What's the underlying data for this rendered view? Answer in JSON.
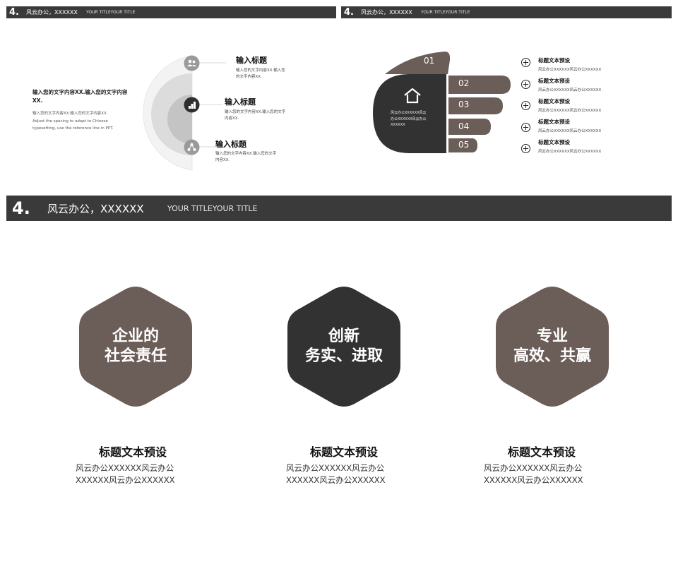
{
  "header": {
    "number": "4.",
    "title": "风云办公，XXXXXX",
    "subtitle": "YOUR TITLEYOUR TITLE"
  },
  "slide1": {
    "intro_title": "输入您的文字内容XX.输入您的文字内容XX.",
    "intro_body": "输入您的文字内容XX.输入您的文字内容XX.\nAdjust the spacing to adapt to Chinese\ntypesetting, use the reference line in PPT.",
    "items": [
      {
        "icon": "people-icon",
        "title": "输入标题",
        "body": "输入您的文字内容XX.输入您\n的文字内容XX."
      },
      {
        "icon": "steps-icon",
        "title": "输入标题",
        "body": "输入您的文字内容XX.输入您的文字\n内容XX."
      },
      {
        "icon": "network-icon",
        "title": "输入标题",
        "body": "输入您的文字内容XX.输入您的文字\n内容XX."
      }
    ]
  },
  "slide2": {
    "palm_text": "风云办公XXXXXX风云\n办公XXXXXX风云办公\nXXXXXX",
    "fingers": [
      "01",
      "02",
      "03",
      "04",
      "05"
    ],
    "items": [
      {
        "title": "标题文本预设",
        "body": "风云办公XXXXXX风云办公XXXXXX"
      },
      {
        "title": "标题文本预设",
        "body": "风云办公XXXXXX风云办公XXXXXX"
      },
      {
        "title": "标题文本预设",
        "body": "风云办公XXXXXX风云办公XXXXXX"
      },
      {
        "title": "标题文本预设",
        "body": "风云办公XXXXXX风云办公XXXXXX"
      },
      {
        "title": "标题文本预设",
        "body": "风云办公XXXXXX风云办公XXXXXX"
      }
    ]
  },
  "slide3": {
    "items": [
      {
        "hex_label": "企业的\n社会责任",
        "color": "#6b5d58",
        "title": "标题文本预设",
        "body": "风云办公XXXXXX风云办公\nXXXXXX风云办公XXXXXX"
      },
      {
        "hex_label": "创新\n务实、进取",
        "color": "#333232",
        "title": "标题文本预设",
        "body": "风云办公XXXXXX风云办公\nXXXXXX风云办公XXXXXX"
      },
      {
        "hex_label": "专业\n高效、共赢",
        "color": "#6b5d58",
        "title": "标题文本预设",
        "body": "风云办公XXXXXX风云办公\nXXXXXX风云办公XXXXXX"
      }
    ]
  },
  "colors": {
    "dark": "#3a3a3a",
    "brown": "#6b5d58"
  }
}
